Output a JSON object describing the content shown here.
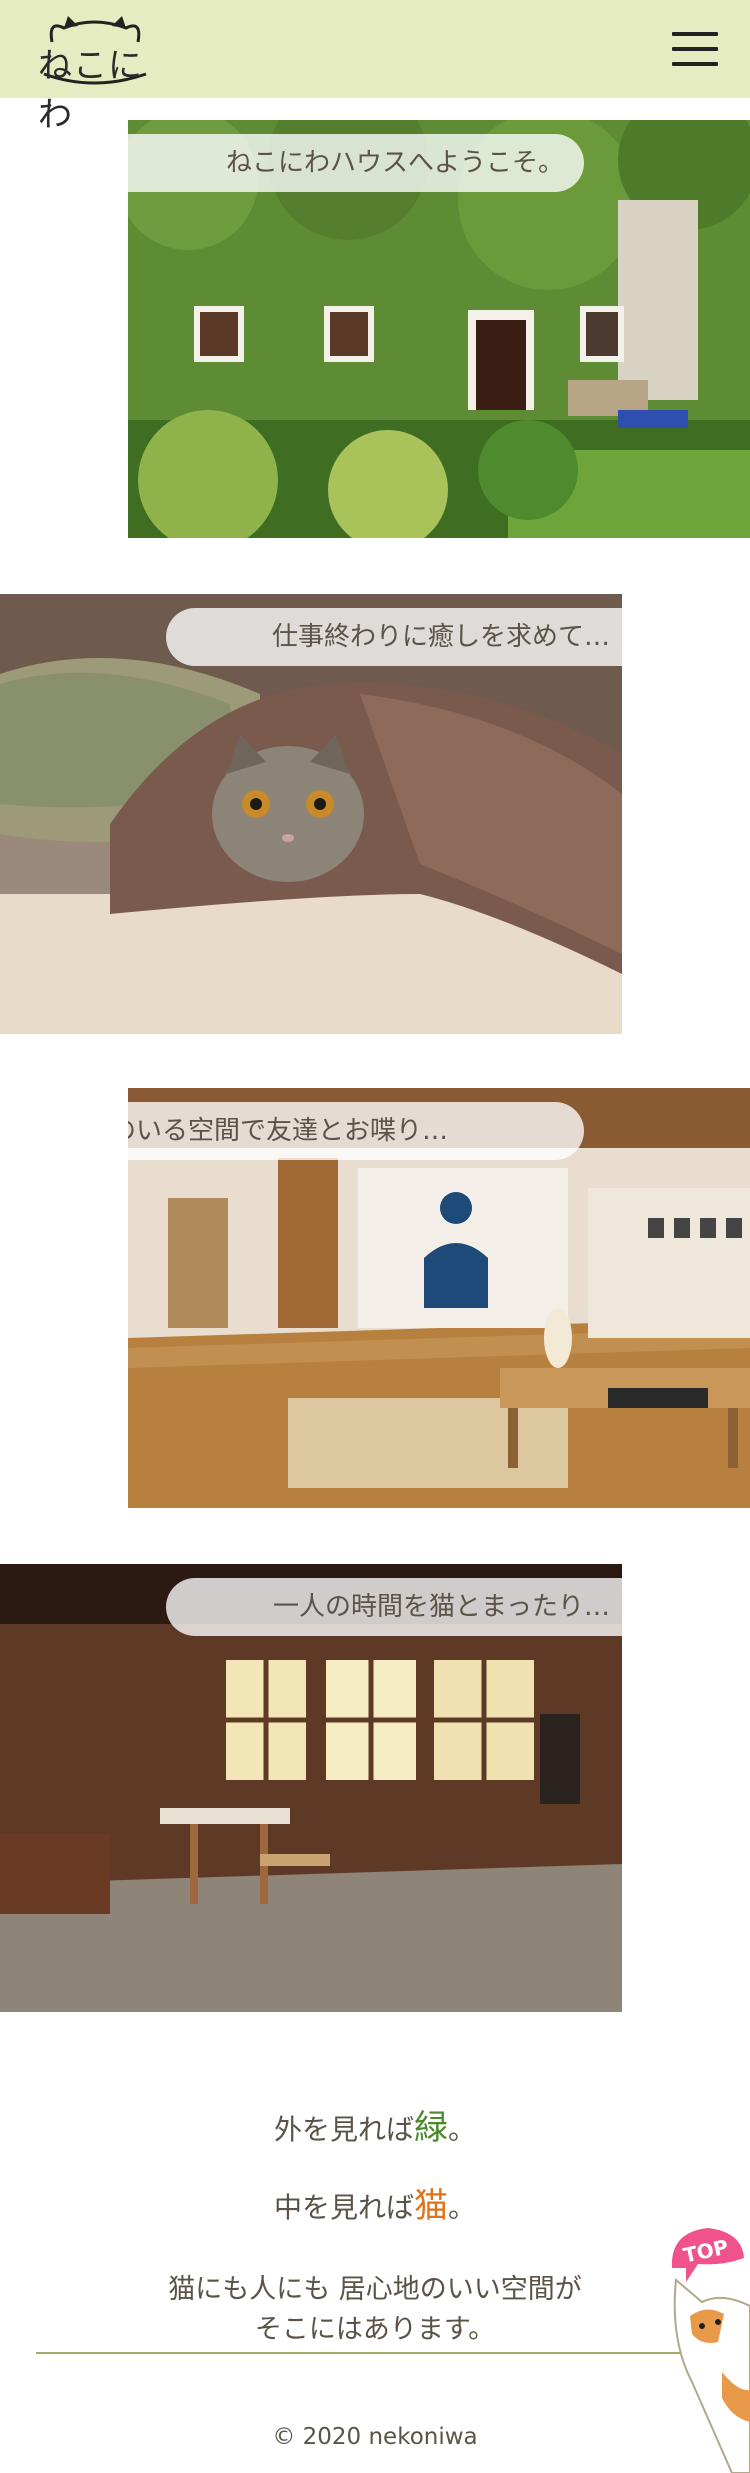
{
  "header": {
    "logo_text": "ねこにわ",
    "menu_label": ""
  },
  "sections": [
    {
      "caption": "ねこにわハウスへようこそ。",
      "image": "ivy-covered-house-with-garden"
    },
    {
      "caption": "仕事終わりに癒しを求めて…",
      "image": "cat-under-blanket"
    },
    {
      "caption": "猫のいる空間で友達とお喋り…",
      "image": "wooden-living-room"
    },
    {
      "caption": "一人の時間を猫とまったり…",
      "image": "rustic-wooden-cabin-room"
    }
  ],
  "tagline": {
    "line1_prefix": "外を見れば",
    "line1_accent": "緑",
    "line1_suffix": "。",
    "line2_prefix": "中を見れば",
    "line2_accent": "猫",
    "line2_suffix": "。"
  },
  "description": {
    "line1": "猫にも人にも 居心地のいい空間が",
    "line2": "そこにはあります。"
  },
  "footer": {
    "copyright": "© 2020 nekoniwa"
  },
  "top_button": {
    "label": "TOP"
  },
  "colors": {
    "header_bg": "#e5ecc2",
    "green_accent": "#4a8a2a",
    "orange_accent": "#e1731b",
    "text": "#5b5348",
    "divider": "#9cb06c",
    "top_badge": "#f0528c"
  }
}
